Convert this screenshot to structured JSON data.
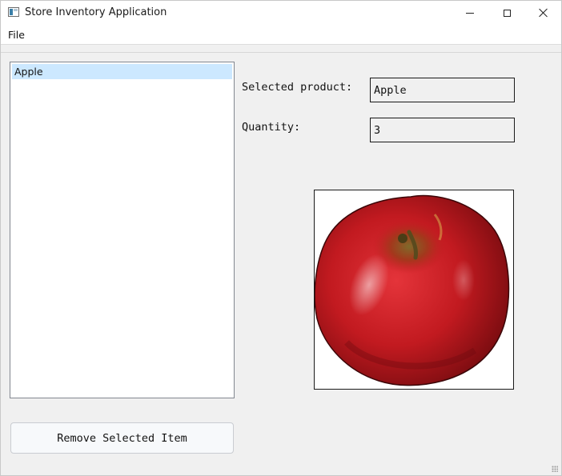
{
  "window": {
    "title": "Store Inventory Application",
    "icon": "app-window-icon",
    "controls": [
      "minimize-icon",
      "maximize-icon",
      "close-icon"
    ]
  },
  "menu": {
    "items": [
      {
        "label": "File"
      }
    ]
  },
  "product_list": {
    "items": [
      {
        "label": "Apple",
        "selected": true
      }
    ]
  },
  "details": {
    "selected_product_label": "Selected product:",
    "selected_product_value": "Apple",
    "quantity_label": "Quantity:",
    "quantity_value": "3"
  },
  "product_image": {
    "subject": "red apple photo"
  },
  "actions": {
    "remove_label": "Remove Selected Item"
  },
  "colors": {
    "selection": "#cce8ff",
    "window_bg": "#f0f0f0",
    "apple_red": "#c8191e"
  }
}
